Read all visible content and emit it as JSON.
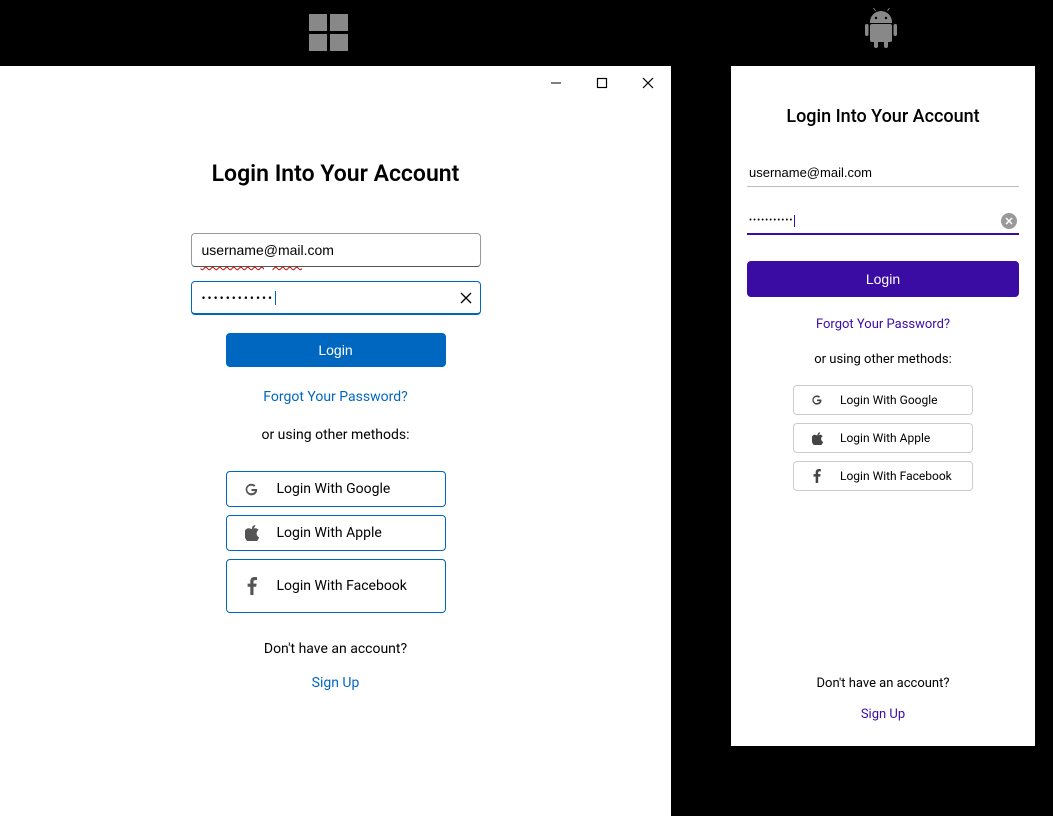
{
  "platforms": {
    "windows_label": "Windows",
    "android_label": "Android"
  },
  "windows": {
    "title": "Login Into Your Account",
    "email_value": "username@mail.com",
    "password_value": "••••••••••••",
    "login_label": "Login",
    "forgot_label": "Forgot Your Password?",
    "or_label": "or using other methods:",
    "social": {
      "google": "Login With Google",
      "apple": "Login With Apple",
      "facebook": "Login With Facebook"
    },
    "no_account": "Don't have an account?",
    "signup_label": "Sign Up",
    "accent_color": "#0067c0"
  },
  "android": {
    "title": "Login Into Your Account",
    "email_value": "username@mail.com",
    "password_value": "•••••••••••",
    "login_label": "Login",
    "forgot_label": "Forgot Your Password?",
    "or_label": "or using other methods:",
    "social": {
      "google": "Login With Google",
      "apple": "Login With Apple",
      "facebook": "Login With Facebook"
    },
    "no_account": "Don't have an account?",
    "signup_label": "Sign Up",
    "accent_color": "#3a0ca3"
  }
}
